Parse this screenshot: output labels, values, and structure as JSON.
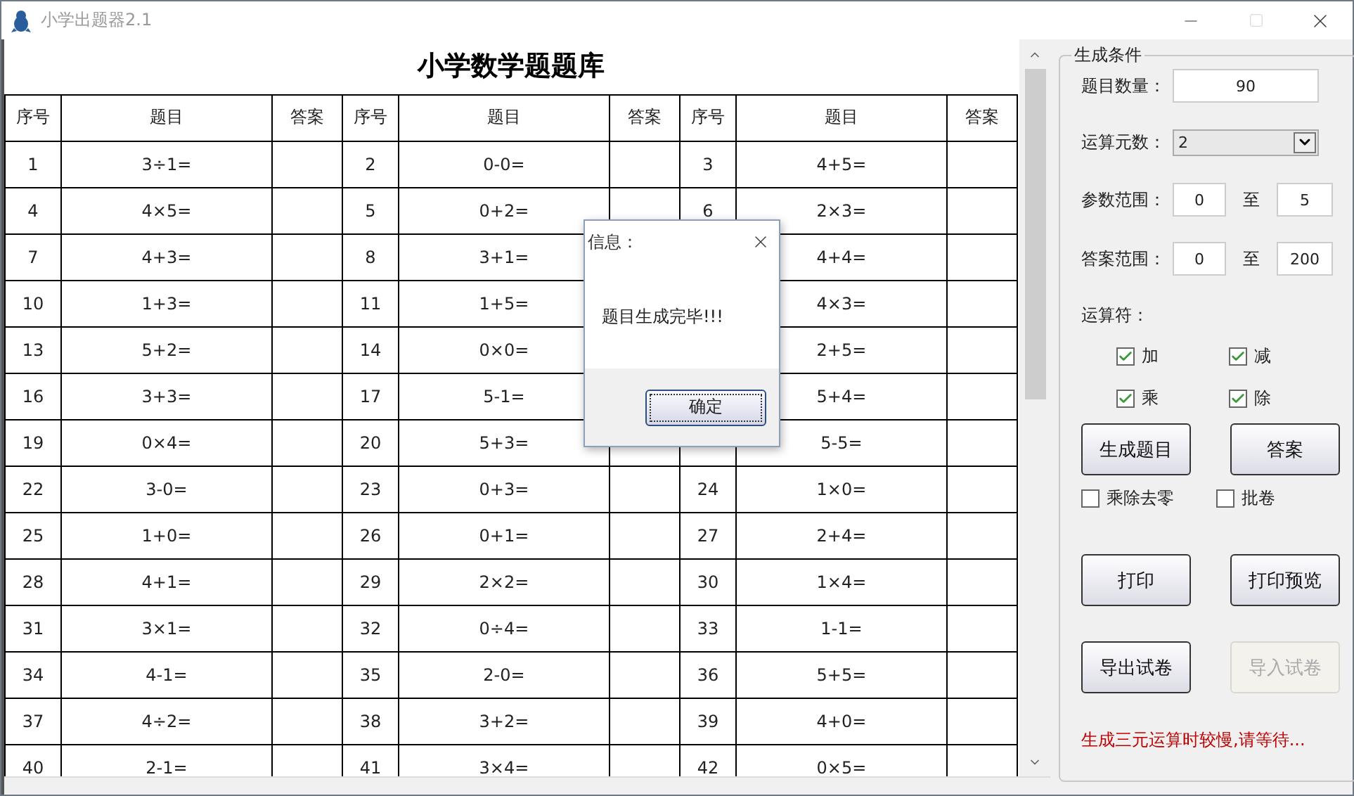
{
  "window": {
    "title": "小学出题器2.1"
  },
  "table": {
    "title": "小学数学题题库",
    "columns": [
      "序号",
      "题目",
      "答案",
      "序号",
      "题目",
      "答案",
      "序号",
      "题目",
      "答案"
    ],
    "rows": [
      [
        {
          "index": "1",
          "question": "3÷1="
        },
        {
          "index": "2",
          "question": "0-0="
        },
        {
          "index": "3",
          "question": "4+5="
        }
      ],
      [
        {
          "index": "4",
          "question": "4×5="
        },
        {
          "index": "5",
          "question": "0+2="
        },
        {
          "index": "6",
          "question": "2×3="
        }
      ],
      [
        {
          "index": "7",
          "question": "4+3="
        },
        {
          "index": "8",
          "question": "3+1="
        },
        {
          "question": "4+4="
        }
      ],
      [
        {
          "index": "10",
          "question": "1+3="
        },
        {
          "index": "11",
          "question": "1+5="
        },
        {
          "question": "4×3="
        }
      ],
      [
        {
          "index": "13",
          "question": "5+2="
        },
        {
          "index": "14",
          "question": "0×0="
        },
        {
          "question": "2+5="
        }
      ],
      [
        {
          "index": "16",
          "question": "3+3="
        },
        {
          "index": "17",
          "question": "5-1="
        },
        {
          "question": "5+4="
        }
      ],
      [
        {
          "index": "19",
          "question": "0×4="
        },
        {
          "index": "20",
          "question": "5+3="
        },
        {
          "question": "5-5="
        }
      ],
      [
        {
          "index": "22",
          "question": "3-0="
        },
        {
          "index": "23",
          "question": "0+3="
        },
        {
          "index": "24",
          "question": "1×0="
        }
      ],
      [
        {
          "index": "25",
          "question": "1+0="
        },
        {
          "index": "26",
          "question": "0+1="
        },
        {
          "index": "27",
          "question": "2+4="
        }
      ],
      [
        {
          "index": "28",
          "question": "4+1="
        },
        {
          "index": "29",
          "question": "2×2="
        },
        {
          "index": "30",
          "question": "1×4="
        }
      ],
      [
        {
          "index": "31",
          "question": "3×1="
        },
        {
          "index": "32",
          "question": "0÷4="
        },
        {
          "index": "33",
          "question": "1-1="
        }
      ],
      [
        {
          "index": "34",
          "question": "4-1="
        },
        {
          "index": "35",
          "question": "2-0="
        },
        {
          "index": "36",
          "question": "5+5="
        }
      ],
      [
        {
          "index": "37",
          "question": "4÷2="
        },
        {
          "index": "38",
          "question": "3+2="
        },
        {
          "index": "39",
          "question": "4+0="
        }
      ],
      [
        {
          "index": "40",
          "question": "2-1="
        },
        {
          "index": "41",
          "question": "3×4="
        },
        {
          "index": "42",
          "question": "0×5="
        }
      ]
    ]
  },
  "dialog": {
    "title": "信息：",
    "message": "题目生成完毕!!!",
    "button": "确定"
  },
  "panel": {
    "title": "生成条件",
    "fields": [
      {
        "kind": "input",
        "label": "题目数量：",
        "value": "90"
      },
      {
        "kind": "select",
        "label": "运算元数：",
        "value": "2"
      },
      {
        "kind": "range",
        "label": "参数范围：",
        "from": "0",
        "separator": "至",
        "to": "5"
      },
      {
        "kind": "range",
        "label": "答案范围：",
        "from": "0",
        "separator": "至",
        "to": "200"
      }
    ],
    "operators": {
      "label": "运算符：",
      "items": [
        {
          "label": "加",
          "checked": true
        },
        {
          "label": "减",
          "checked": true
        },
        {
          "label": "乘",
          "checked": true
        },
        {
          "label": "除",
          "checked": true
        }
      ]
    },
    "generate_buttons": [
      {
        "label": "生成题目",
        "disabled": false
      },
      {
        "label": "答案",
        "disabled": false
      }
    ],
    "options": [
      {
        "label": "乘除去零",
        "checked": false
      },
      {
        "label": "批卷",
        "checked": false
      }
    ],
    "print_buttons": [
      {
        "label": "打印",
        "disabled": false
      },
      {
        "label": "打印预览",
        "disabled": false
      }
    ],
    "file_buttons": [
      {
        "label": "导出试卷",
        "disabled": false
      },
      {
        "label": "导入试卷",
        "disabled": true
      }
    ],
    "notice": "生成三元运算时较慢,请等待..."
  }
}
